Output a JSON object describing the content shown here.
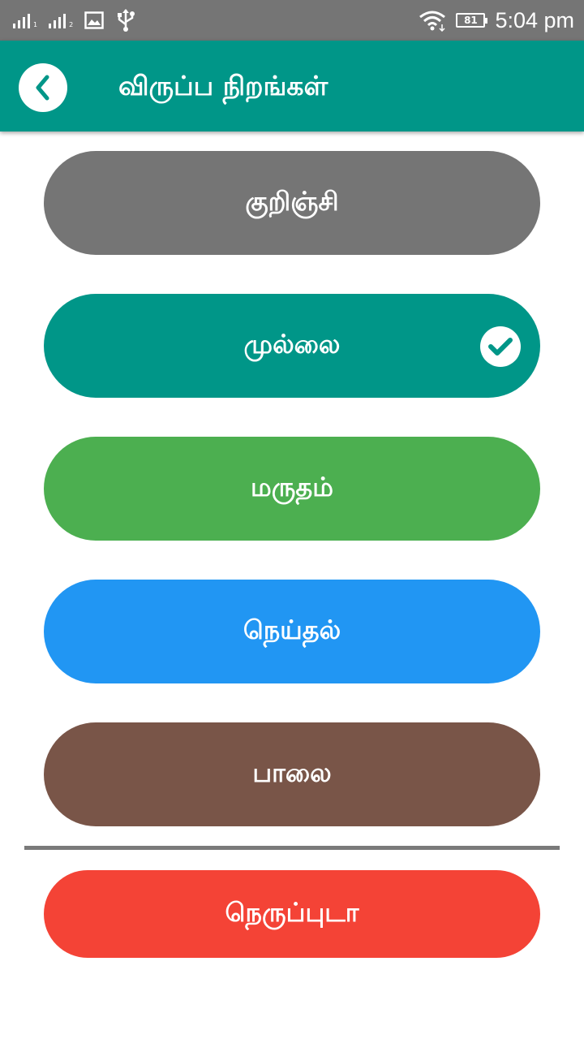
{
  "status_bar": {
    "sim1_label": "1",
    "sim2_label": "2",
    "battery": "81",
    "time": "5:04 pm",
    "icons": [
      "signal-icon",
      "signal-icon",
      "image-icon",
      "usb-icon",
      "wifi-icon",
      "battery-icon"
    ]
  },
  "header": {
    "title": "விருப்ப நிறங்கள்",
    "back_icon": "chevron-left-icon",
    "color": "#009688"
  },
  "options": [
    {
      "label": "குறிஞ்சி",
      "color": "#757575",
      "selected": false
    },
    {
      "label": "முல்லை",
      "color": "#009688",
      "selected": true
    },
    {
      "label": "மருதம்",
      "color": "#4CAF50",
      "selected": false
    },
    {
      "label": "நெய்தல்",
      "color": "#2196F3",
      "selected": false
    },
    {
      "label": "பாலை",
      "color": "#795548",
      "selected": false
    }
  ],
  "delete_button": {
    "label": "நெருப்புடா",
    "color": "#F44336"
  }
}
